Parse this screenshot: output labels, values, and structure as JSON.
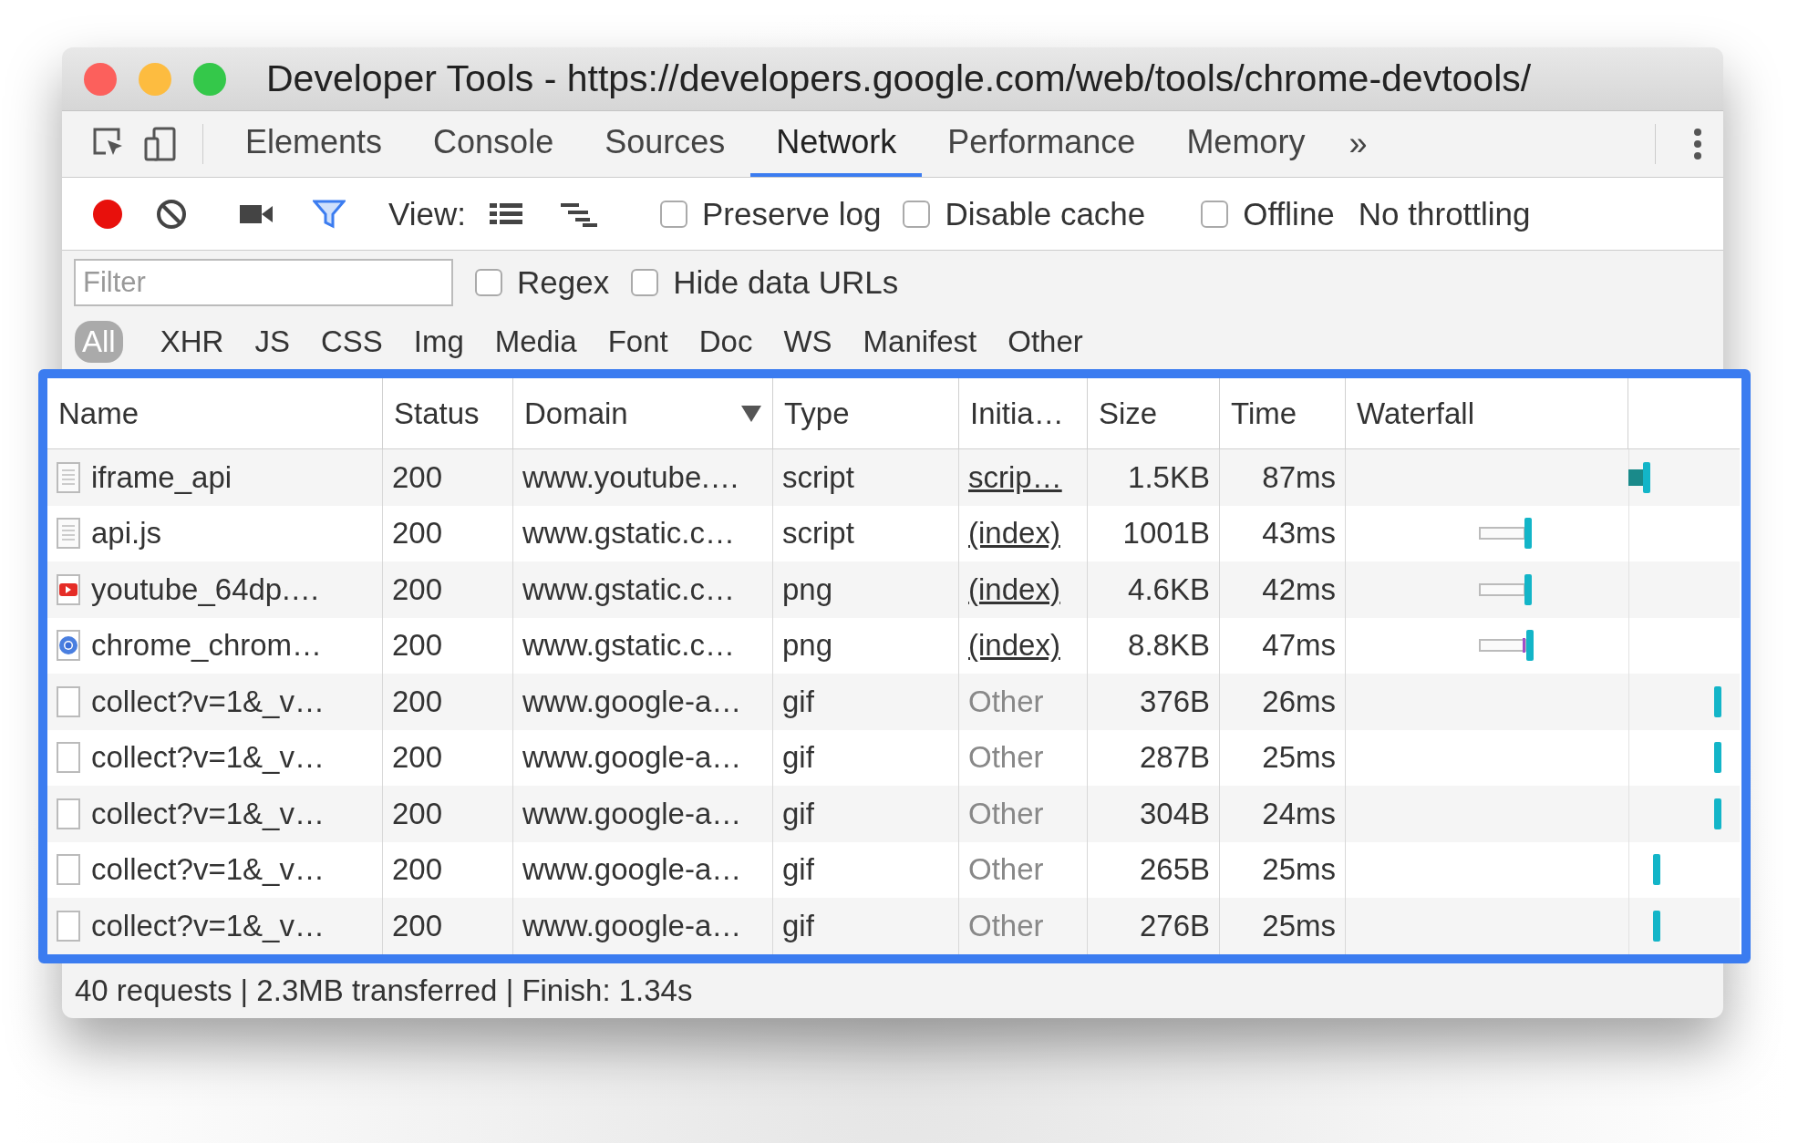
{
  "window": {
    "title": "Developer Tools - https://developers.google.com/web/tools/chrome-devtools/"
  },
  "tabs": [
    {
      "label": "Elements",
      "selected": false
    },
    {
      "label": "Console",
      "selected": false
    },
    {
      "label": "Sources",
      "selected": false
    },
    {
      "label": "Network",
      "selected": true
    },
    {
      "label": "Performance",
      "selected": false
    },
    {
      "label": "Memory",
      "selected": false
    }
  ],
  "more_tabs": "»",
  "toolbar": {
    "recording": true,
    "filter_active": true,
    "view_label": "View:",
    "checkboxes": [
      {
        "label": "Preserve log",
        "checked": false
      },
      {
        "label": "Disable cache",
        "checked": false
      },
      {
        "label": "Offline",
        "checked": false
      }
    ],
    "throttling": "No throttling"
  },
  "filter_bar": {
    "placeholder": "Filter",
    "options": [
      {
        "label": "Regex",
        "checked": false
      },
      {
        "label": "Hide data URLs",
        "checked": false
      }
    ]
  },
  "type_filters": [
    {
      "label": "All",
      "selected": true
    },
    {
      "label": "XHR",
      "selected": false
    },
    {
      "label": "JS",
      "selected": false
    },
    {
      "label": "CSS",
      "selected": false
    },
    {
      "label": "Img",
      "selected": false
    },
    {
      "label": "Media",
      "selected": false
    },
    {
      "label": "Font",
      "selected": false
    },
    {
      "label": "Doc",
      "selected": false
    },
    {
      "label": "WS",
      "selected": false
    },
    {
      "label": "Manifest",
      "selected": false
    },
    {
      "label": "Other",
      "selected": false
    }
  ],
  "table": {
    "columns": [
      "Name",
      "Status",
      "Domain",
      "Type",
      "Initia…",
      "Size",
      "Time",
      "Waterfall"
    ],
    "rows": [
      {
        "kind": "document",
        "name": "iframe_api",
        "status": "200",
        "domain": "www.youtube.…",
        "type": "script",
        "initiator": "scrip…",
        "initiator_link": true,
        "size": "1.5KB",
        "time": "87ms"
      },
      {
        "kind": "document",
        "name": "api.js",
        "status": "200",
        "domain": "www.gstatic.c…",
        "type": "script",
        "initiator": "(index)",
        "initiator_link": true,
        "size": "1001B",
        "time": "43ms"
      },
      {
        "kind": "video-image",
        "name": "youtube_64dp.…",
        "status": "200",
        "domain": "www.gstatic.c…",
        "type": "png",
        "initiator": "(index)",
        "initiator_link": true,
        "size": "4.6KB",
        "time": "42ms"
      },
      {
        "kind": "browser-image",
        "name": "chrome_chrom…",
        "status": "200",
        "domain": "www.gstatic.c…",
        "type": "png",
        "initiator": "(index)",
        "initiator_link": true,
        "size": "8.8KB",
        "time": "47ms"
      },
      {
        "kind": "blank",
        "name": "collect?v=1&_v…",
        "status": "200",
        "domain": "www.google-a…",
        "type": "gif",
        "initiator": "Other",
        "initiator_link": false,
        "size": "376B",
        "time": "26ms"
      },
      {
        "kind": "blank",
        "name": "collect?v=1&_v…",
        "status": "200",
        "domain": "www.google-a…",
        "type": "gif",
        "initiator": "Other",
        "initiator_link": false,
        "size": "287B",
        "time": "25ms"
      },
      {
        "kind": "blank",
        "name": "collect?v=1&_v…",
        "status": "200",
        "domain": "www.google-a…",
        "type": "gif",
        "initiator": "Other",
        "initiator_link": false,
        "size": "304B",
        "time": "24ms"
      },
      {
        "kind": "blank",
        "name": "collect?v=1&_v…",
        "status": "200",
        "domain": "www.google-a…",
        "type": "gif",
        "initiator": "Other",
        "initiator_link": false,
        "size": "265B",
        "time": "25ms"
      },
      {
        "kind": "blank",
        "name": "collect?v=1&_v…",
        "status": "200",
        "domain": "www.google-a…",
        "type": "gif",
        "initiator": "Other",
        "initiator_link": false,
        "size": "276B",
        "time": "25ms"
      }
    ]
  },
  "status_bar": "40 requests | 2.3MB transferred | Finish: 1.34s"
}
